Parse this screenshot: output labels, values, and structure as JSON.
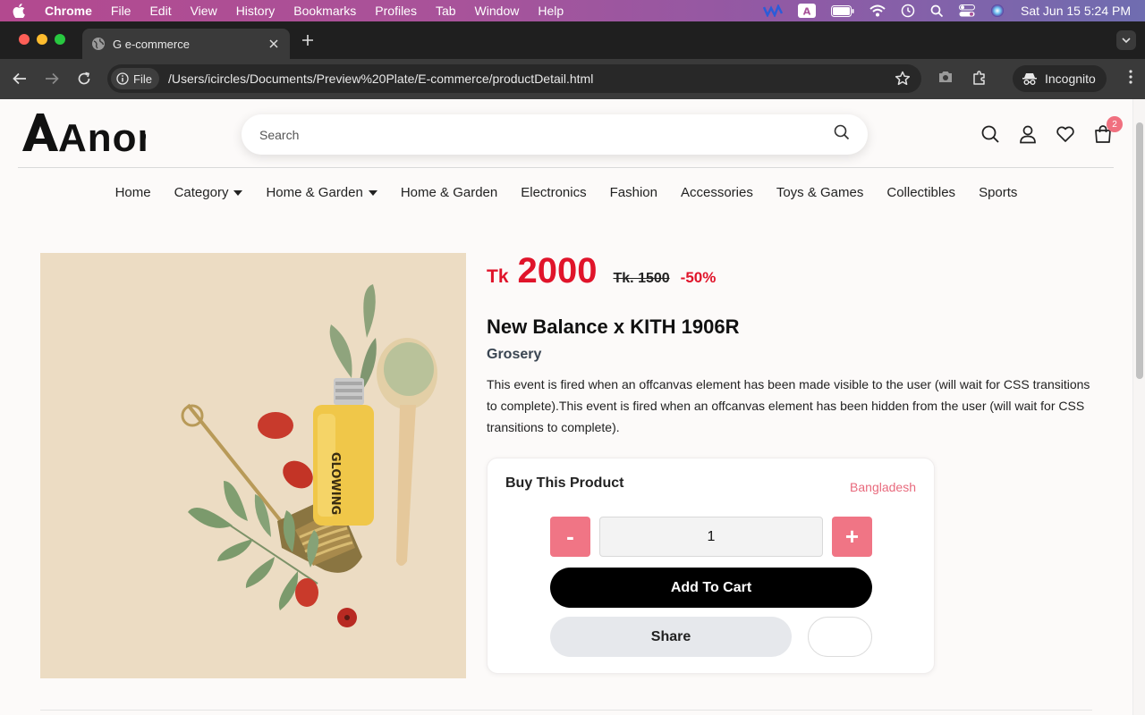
{
  "menubar": {
    "app": "Chrome",
    "items": [
      "File",
      "Edit",
      "View",
      "History",
      "Bookmarks",
      "Profiles",
      "Tab",
      "Window",
      "Help"
    ],
    "datetime": "Sat Jun 15  5:24 PM"
  },
  "browser": {
    "tab_title": "G e-commerce",
    "chip_label": "File",
    "url": "/Users/icircles/Documents/Preview%20Plate/E-commerce/productDetail.html",
    "incognito_label": "Incognito"
  },
  "site": {
    "logo": "Anon",
    "search_placeholder": "Search",
    "cart_count": "2",
    "nav": [
      {
        "label": "Home"
      },
      {
        "label": "Category"
      },
      {
        "label": "Home & Garden"
      },
      {
        "label": "Home & Garden"
      },
      {
        "label": "Electronics"
      },
      {
        "label": "Fashion"
      },
      {
        "label": "Accessories"
      },
      {
        "label": "Toys & Games"
      },
      {
        "label": "Collectibles"
      },
      {
        "label": "Sports"
      }
    ]
  },
  "product": {
    "currency": "Tk",
    "price": "2000",
    "old_price": "Tk. 1500",
    "discount": "-50%",
    "name": "New Balance x KITH 1906R",
    "category": "Grosery",
    "description": "This event is fired when an offcanvas element has been made visible to the user (will wait for CSS transitions to complete).This event is fired when an offcanvas element has been hidden from the user (will wait for CSS transitions to complete).",
    "image_label": "GLOWING"
  },
  "buy": {
    "title": "Buy This Product",
    "country": "Bangladesh",
    "minus": "-",
    "plus": "+",
    "quantity": "1",
    "add_to_cart": "Add To Cart",
    "share": "Share"
  },
  "colors": {
    "accent": "#e0142a",
    "pink": "#f07585",
    "menubar": "#a8539a"
  }
}
